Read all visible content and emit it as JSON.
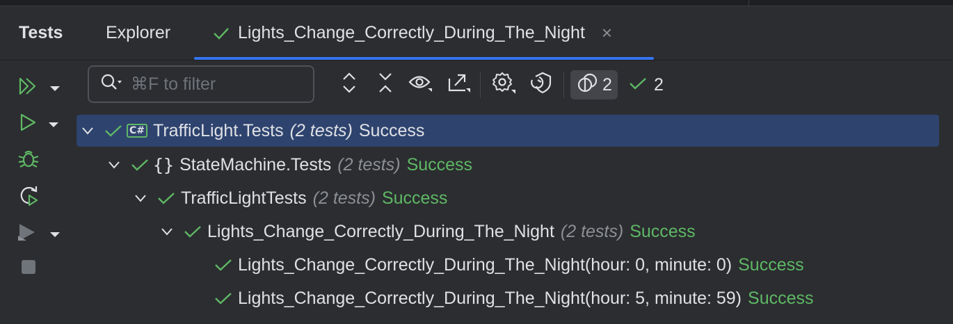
{
  "tabs": {
    "tests": "Tests",
    "explorer": "Explorer",
    "active": "Lights_Change_Correctly_During_The_Night",
    "close": "×"
  },
  "search": {
    "placeholder": "⌘F to filter",
    "value": ""
  },
  "toolbar": {
    "inactive_count": "2",
    "passed_count": "2"
  },
  "tree": [
    {
      "name": "TrafficLight.Tests",
      "count": "(2 tests)",
      "status": "Success",
      "icon": "csharp-project-icon",
      "icon_text": "C#"
    },
    {
      "name": "StateMachine.Tests",
      "count": "(2 tests)",
      "status": "Success",
      "icon": "namespace-icon",
      "icon_text": "{}"
    },
    {
      "name": "TrafficLightTests",
      "count": "(2 tests)",
      "status": "Success"
    },
    {
      "name": "Lights_Change_Correctly_During_The_Night",
      "count": "(2 tests)",
      "status": "Success"
    },
    {
      "name": "Lights_Change_Correctly_During_The_Night(hour: 0, minute: 0)",
      "status": "Success"
    },
    {
      "name": "Lights_Change_Correctly_During_The_Night(hour: 5, minute: 59)",
      "status": "Success"
    }
  ],
  "colors": {
    "accent": "#3574f0",
    "success": "#5fb865",
    "selection": "#2e436e",
    "background": "#2b2d30"
  },
  "icons": [
    "run-all-icon",
    "run-icon",
    "debug-icon",
    "rerun-icon",
    "coverage-icon",
    "stop-icon",
    "expand-all-icon",
    "collapse-all-icon",
    "show-icon",
    "export-icon",
    "settings-icon",
    "track-running-icon",
    "filter-inactive-icon",
    "check-icon",
    "chevron-down-icon"
  ]
}
